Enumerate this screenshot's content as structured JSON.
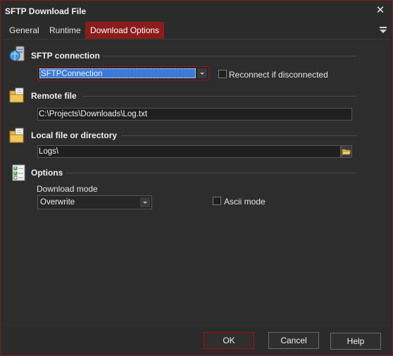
{
  "window": {
    "title": "SFTP Download File",
    "close_glyph": "✕"
  },
  "tabs": [
    {
      "label": "General",
      "active": false
    },
    {
      "label": "Runtime",
      "active": false
    },
    {
      "label": "Download Options",
      "active": true
    }
  ],
  "sections": {
    "sftp": {
      "title": "SFTP connection",
      "icon": "server-globe-icon",
      "connection_value": "SFTPConnection",
      "reconnect_label": "Reconnect if disconnected",
      "reconnect_checked": false
    },
    "remote": {
      "title": "Remote file",
      "icon": "folder-document-icon",
      "value": "C:\\Projects\\Downloads\\Log.txt"
    },
    "local": {
      "title": "Local file or directory",
      "icon": "folder-document-icon",
      "value": "Logs\\",
      "browse_icon": "folder-open-icon"
    },
    "options": {
      "title": "Options",
      "icon": "checklist-icon",
      "download_mode_label": "Download mode",
      "download_mode_value": "Overwrite",
      "ascii_label": "Ascii mode",
      "ascii_checked": false
    }
  },
  "buttons": {
    "ok": "OK",
    "cancel": "Cancel",
    "help": "Help"
  },
  "colors": {
    "accent": "#8b1c1c",
    "selection": "#3d7ad6",
    "background": "#2b2b2b"
  }
}
